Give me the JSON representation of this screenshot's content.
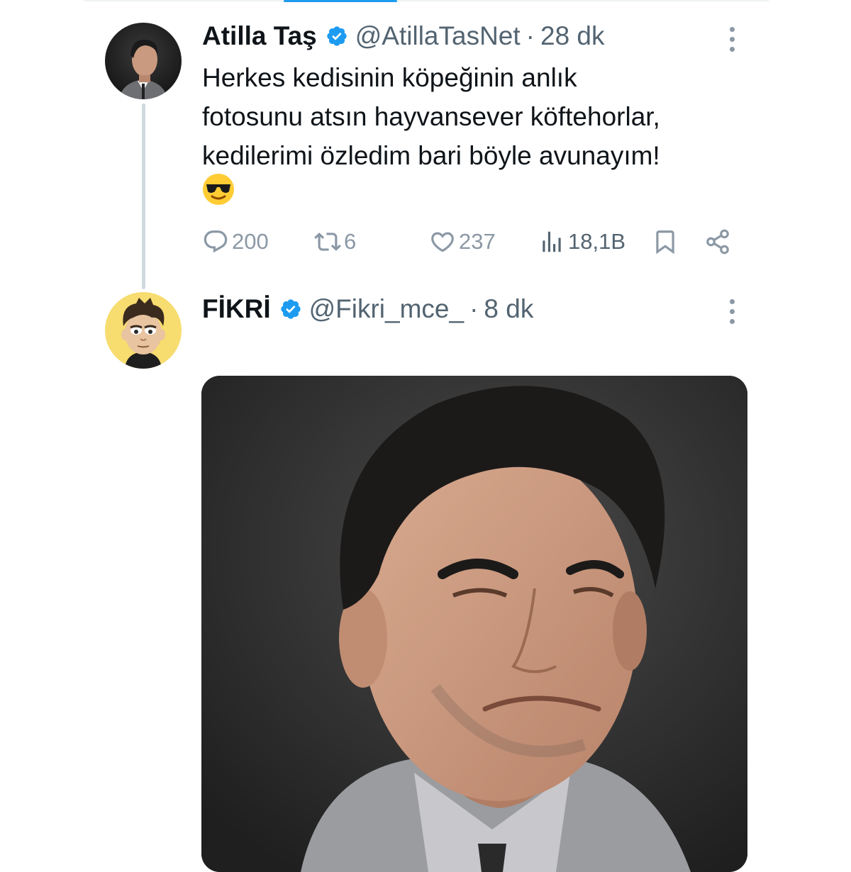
{
  "tweet_main": {
    "name": "Atilla Taş",
    "handle": "@AtillaTasNet",
    "separator": "·",
    "time": "28 dk",
    "text_lines": [
      "Herkes kedisinin köpeğinin anlık",
      "fotosunu atsın hayvansever köftehorlar,",
      "kedilerimi özledim bari böyle avunayım!"
    ],
    "emoji": "smiling-face-with-sunglasses",
    "actions": {
      "replies": "200",
      "retweets": "6",
      "likes": "237",
      "views": "18,1B"
    }
  },
  "tweet_reply": {
    "name": "FİKRİ",
    "handle": "@Fikri_mce_",
    "separator": "·",
    "time": "8 dk"
  },
  "colors": {
    "verified": "#1d9bf0",
    "secondary_text": "#536471",
    "icon_gray": "#8b98a5",
    "thread_line": "#cfd9de",
    "reply_avatar_bg": "#f7dc6f"
  },
  "icons": [
    "verified-badge-icon",
    "more-options-icon",
    "reply-icon",
    "retweet-icon",
    "like-icon",
    "views-icon",
    "bookmark-icon",
    "share-icon"
  ]
}
